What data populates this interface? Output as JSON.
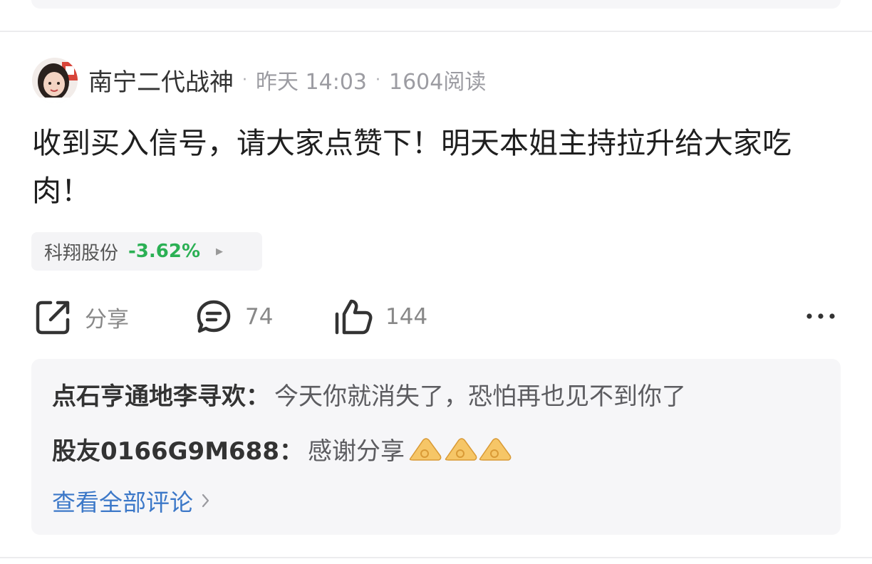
{
  "post": {
    "author": "南宁二代战神",
    "meta_dot": "·",
    "time": "昨天 14:03",
    "reads": "1604阅读",
    "content": "收到买入信号，请大家点赞下！明天本姐主持拉升给大家吃肉！",
    "stock": {
      "name": "科翔股份",
      "change": "-3.62%",
      "arrow": "▶"
    },
    "actions": {
      "share_label": "分享",
      "comment_count": "74",
      "like_count": "144"
    }
  },
  "comments": {
    "items": [
      {
        "user": "点石亨通地李寻欢",
        "sep": "：",
        "text": "今天你就消失了，恐怕再也见不到你了"
      },
      {
        "user": "股友0166G9M688",
        "sep": "：",
        "text": "感谢分享"
      }
    ],
    "view_all": "查看全部评论"
  },
  "icons": {
    "share": "share-icon",
    "comment": "comment-icon",
    "like": "thumbs-up-icon",
    "more": "more-horizontal-icon",
    "emoji": "ok-hand-emoji-icon",
    "chevron": "chevron-right-icon"
  },
  "colors": {
    "negative": "#2bb054",
    "link": "#3c78c8",
    "text": "#1f1f1f",
    "muted": "#9c9ca2"
  }
}
